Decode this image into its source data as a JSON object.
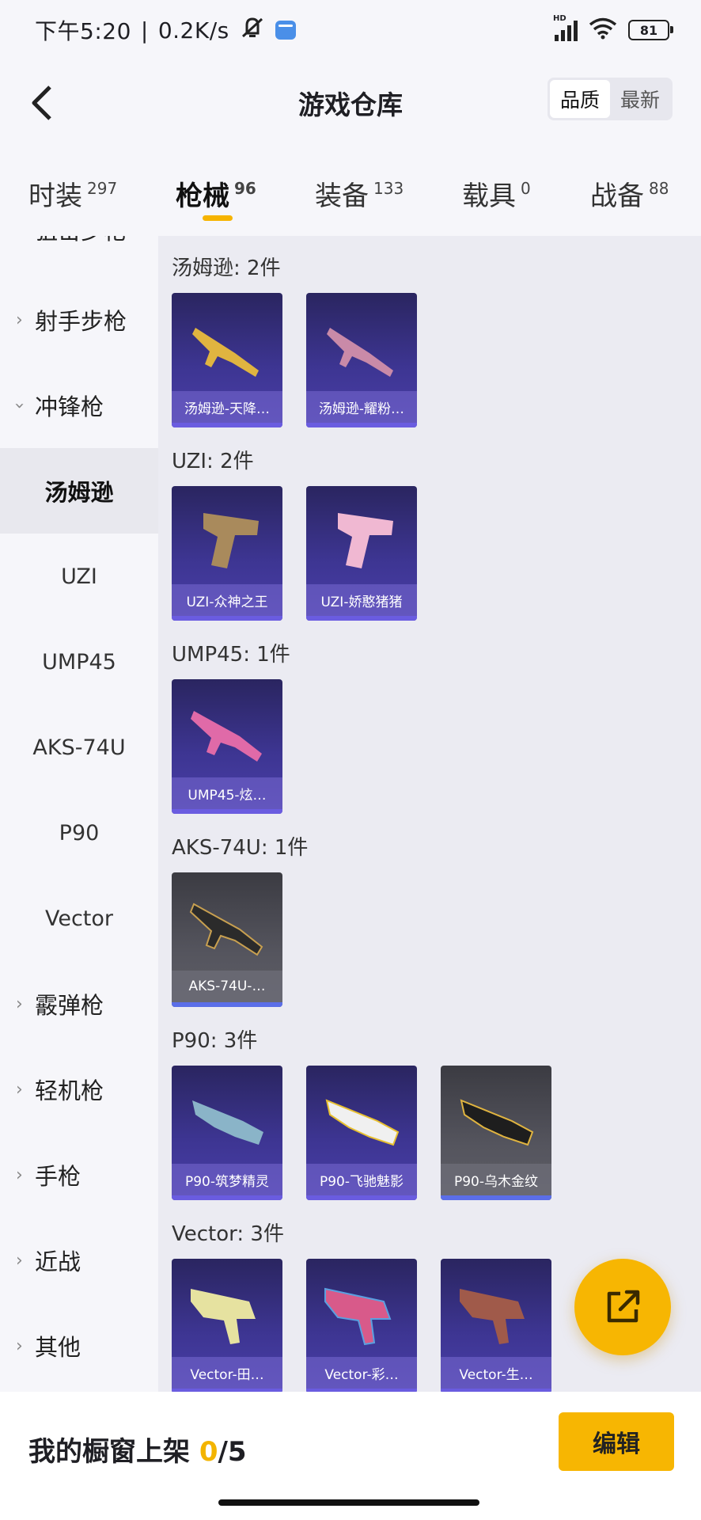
{
  "status_bar": {
    "time": "下午5:20",
    "speed": "0.2K/s",
    "battery": "81",
    "hd": "HD"
  },
  "header": {
    "title": "游戏仓库",
    "sort_quality": "品质",
    "sort_latest": "最新"
  },
  "tabs": [
    {
      "label": "时装",
      "count": "297"
    },
    {
      "label": "枪械",
      "count": "96"
    },
    {
      "label": "装备",
      "count": "133"
    },
    {
      "label": "载具",
      "count": "0"
    },
    {
      "label": "战备",
      "count": "88"
    }
  ],
  "sidebar": {
    "cut_item": "狙击步枪",
    "categories": [
      "射手步枪",
      "冲锋枪",
      "霰弹枪",
      "轻机枪",
      "手枪",
      "近战",
      "其他"
    ],
    "sub_items": [
      "汤姆逊",
      "UZI",
      "UMP45",
      "AKS-74U",
      "P90",
      "Vector"
    ]
  },
  "groups": [
    {
      "title": "汤姆逊: 2件",
      "items": [
        "汤姆逊-天降…",
        "汤姆逊-耀粉…"
      ]
    },
    {
      "title": "UZI: 2件",
      "items": [
        "UZI-众神之王",
        "UZI-娇憨猪猪"
      ]
    },
    {
      "title": "UMP45: 1件",
      "items": [
        "UMP45-炫…"
      ]
    },
    {
      "title": "AKS-74U: 1件",
      "items": [
        "AKS-74U-…"
      ]
    },
    {
      "title": "P90: 3件",
      "items": [
        "P90-筑梦精灵",
        "P90-飞驰魅影",
        "P90-乌木金纹"
      ]
    },
    {
      "title": "Vector: 3件",
      "items": [
        "Vector-田…",
        "Vector-彩…",
        "Vector-生…"
      ]
    }
  ],
  "bottom_bar": {
    "shelf_label": "我的橱窗上架",
    "shelf_count": "0",
    "shelf_total": "/5",
    "edit_label": "编辑"
  },
  "colors": {
    "accent": "#f7b602",
    "card_purple": "#3d3592",
    "card_grey": "#55555e"
  }
}
